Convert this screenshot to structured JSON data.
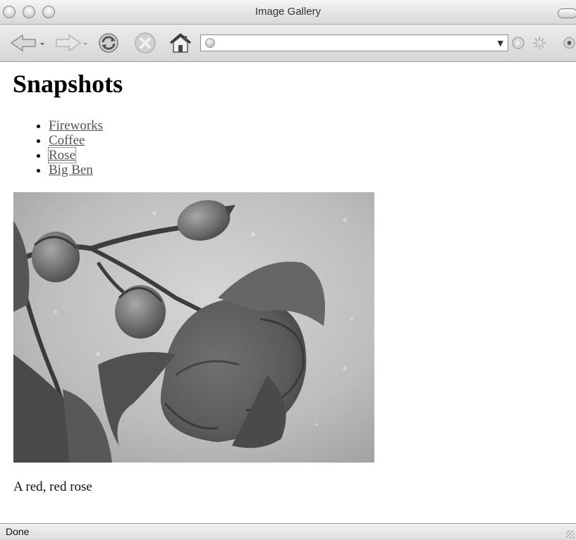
{
  "window": {
    "title": "Image Gallery"
  },
  "toolbar": {
    "back_icon": "back-arrow-icon",
    "forward_icon": "forward-arrow-icon",
    "reload_icon": "reload-icon",
    "stop_icon": "stop-icon",
    "home_icon": "home-icon",
    "url_value": ""
  },
  "page": {
    "heading": "Snapshots",
    "nav": [
      {
        "label": "Fireworks"
      },
      {
        "label": "Coffee"
      },
      {
        "label": "Rose"
      },
      {
        "label": "Big Ben"
      }
    ],
    "selected_index": 2,
    "caption": "A red, red rose"
  },
  "status": {
    "text": "Done"
  }
}
